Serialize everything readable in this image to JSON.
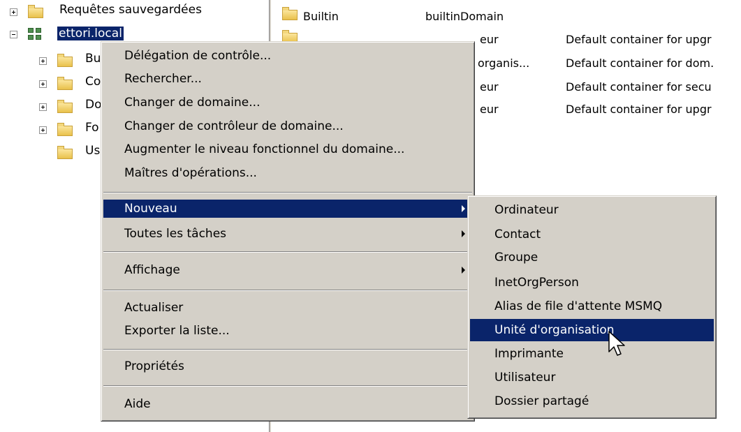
{
  "tree": {
    "items": [
      {
        "label": "Requêtes sauvegardées"
      },
      {
        "label": "ettori.local"
      },
      {
        "label": "Bu"
      },
      {
        "label": "Co"
      },
      {
        "label": "Do"
      },
      {
        "label": "Fo"
      },
      {
        "label": "Us"
      }
    ]
  },
  "list": {
    "rows": [
      {
        "name": "Builtin",
        "type": "builtinDomain",
        "description": ""
      },
      {
        "name": "",
        "type": "eur",
        "description": "Default container for upgr"
      },
      {
        "name": "",
        "type": "organis...",
        "description": "Default container for dom."
      },
      {
        "name": "",
        "type": "eur",
        "description": "Default container for secu"
      },
      {
        "name": "",
        "type": "eur",
        "description": "Default container for upgr"
      }
    ]
  },
  "context_menu": {
    "items": [
      "Délégation de contrôle...",
      "Rechercher...",
      "Changer de domaine...",
      "Changer de contrôleur de domaine...",
      "Augmenter le niveau fonctionnel du domaine...",
      "Maîtres d'opérations...",
      "Nouveau",
      "Toutes les tâches",
      "Affichage",
      "Actualiser",
      "Exporter la liste...",
      "Propriétés",
      "Aide"
    ],
    "highlighted": "Nouveau"
  },
  "submenu": {
    "items": [
      "Ordinateur",
      "Contact",
      "Groupe",
      "InetOrgPerson",
      "Alias de file d'attente MSMQ",
      "Unité d'organisation",
      "Imprimante",
      "Utilisateur",
      "Dossier partagé"
    ],
    "highlighted": "Unité d'organisation"
  },
  "colors": {
    "highlight": "#0a246a",
    "menu_bg": "#d4d0c8"
  }
}
